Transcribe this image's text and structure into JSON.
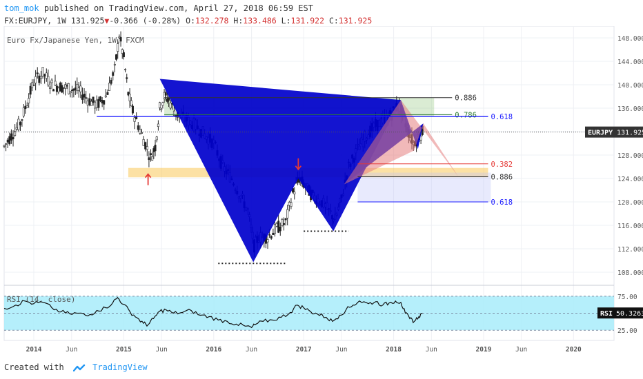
{
  "header": {
    "user": "tom_mok",
    "published": "published on TradingView.com, April 27, 2018 06:59 EST"
  },
  "quote": {
    "symbol": "FX:EURJPY, 1W 131.925",
    "change": "-0.366 (-0.28%)",
    "open_label": "O:",
    "open": "132.278",
    "high_label": "H:",
    "high": "133.486",
    "low_label": "L:",
    "low": "131.922",
    "close_label": "C:",
    "close": "131.925"
  },
  "footer": {
    "created_with": "Created with",
    "brand": "TradingView"
  },
  "colors": {
    "bull": "#0000cc",
    "bear": "#e58080",
    "rsi_band": "#a8ecfa",
    "neg": "#d32f2f",
    "accent": "#2196f3"
  },
  "chart_data": {
    "type": "candlestick",
    "title": "Euro Fx/Japanese Yen, 1W, FXCM",
    "price_axis": {
      "ticks": [
        108,
        112,
        116,
        120,
        124,
        128,
        132,
        136,
        140,
        144,
        148
      ],
      "ylim": [
        106,
        150
      ]
    },
    "x_axis": {
      "range": [
        2013.67,
        2020.45
      ],
      "ticks": [
        {
          "x": 2014.0,
          "label": "2014"
        },
        {
          "x": 2014.42,
          "label": "Jun"
        },
        {
          "x": 2015.0,
          "label": "2015"
        },
        {
          "x": 2015.42,
          "label": "Jun"
        },
        {
          "x": 2016.0,
          "label": "2016"
        },
        {
          "x": 2016.42,
          "label": "Jun"
        },
        {
          "x": 2017.0,
          "label": "2017"
        },
        {
          "x": 2017.42,
          "label": "Jun"
        },
        {
          "x": 2018.0,
          "label": "2018"
        },
        {
          "x": 2018.42,
          "label": "Jun"
        },
        {
          "x": 2019.0,
          "label": "2019"
        },
        {
          "x": 2019.42,
          "label": "Jun"
        },
        {
          "x": 2020.0,
          "label": "2020"
        }
      ]
    },
    "last_price": {
      "label": "EURJPY",
      "value": "131.925"
    },
    "price_path": [
      [
        2013.67,
        129.5
      ],
      [
        2013.85,
        133.5
      ],
      [
        2014.0,
        140.5
      ],
      [
        2014.1,
        142.0
      ],
      [
        2014.2,
        140.0
      ],
      [
        2014.35,
        139.5
      ],
      [
        2014.5,
        139.0
      ],
      [
        2014.6,
        137.5
      ],
      [
        2014.7,
        136.5
      ],
      [
        2014.8,
        138.0
      ],
      [
        2014.9,
        142.5
      ],
      [
        2014.95,
        148.5
      ],
      [
        2015.0,
        144.5
      ],
      [
        2015.05,
        138.5
      ],
      [
        2015.1,
        135.5
      ],
      [
        2015.2,
        131.5
      ],
      [
        2015.3,
        127.5
      ],
      [
        2015.35,
        129.5
      ],
      [
        2015.4,
        136.0
      ],
      [
        2015.45,
        138.0
      ],
      [
        2015.5,
        137.5
      ],
      [
        2015.58,
        135.0
      ],
      [
        2015.7,
        134.0
      ],
      [
        2015.8,
        133.0
      ],
      [
        2015.9,
        131.5
      ],
      [
        2016.0,
        130.0
      ],
      [
        2016.1,
        126.0
      ],
      [
        2016.2,
        124.0
      ],
      [
        2016.3,
        121.0
      ],
      [
        2016.38,
        118.5
      ],
      [
        2016.45,
        112.5
      ],
      [
        2016.5,
        114.0
      ],
      [
        2016.6,
        114.0
      ],
      [
        2016.7,
        115.5
      ],
      [
        2016.8,
        116.5
      ],
      [
        2016.88,
        121.5
      ],
      [
        2016.95,
        124.0
      ],
      [
        2017.0,
        123.0
      ],
      [
        2017.1,
        121.0
      ],
      [
        2017.2,
        120.0
      ],
      [
        2017.3,
        118.0
      ],
      [
        2017.35,
        117.0
      ],
      [
        2017.42,
        120.5
      ],
      [
        2017.5,
        126.0
      ],
      [
        2017.6,
        129.0
      ],
      [
        2017.7,
        131.5
      ],
      [
        2017.8,
        133.0
      ],
      [
        2017.9,
        134.0
      ],
      [
        2017.98,
        135.0
      ],
      [
        2018.05,
        136.5
      ],
      [
        2018.1,
        135.0
      ],
      [
        2018.15,
        132.5
      ],
      [
        2018.22,
        130.0
      ],
      [
        2018.27,
        131.0
      ],
      [
        2018.32,
        131.925
      ]
    ],
    "harmonic_patterns": [
      {
        "color": "bull",
        "points": [
          [
            2015.4,
            141.0
          ],
          [
            2016.44,
            109.7
          ],
          [
            2016.94,
            124.0
          ],
          [
            2017.33,
            115.0
          ],
          [
            2018.08,
            137.4
          ]
        ]
      },
      {
        "color": "bull",
        "points": [
          [
            2017.45,
            123.0
          ],
          [
            2018.08,
            137.4
          ],
          [
            2018.27,
            129.0
          ],
          [
            2018.33,
            133.4
          ]
        ]
      },
      {
        "color": "bear",
        "points": [
          [
            2017.45,
            123.0
          ],
          [
            2018.08,
            137.4
          ],
          [
            2018.23,
            128.8
          ]
        ]
      },
      {
        "color": "bear",
        "points": [
          [
            2018.08,
            137.4
          ],
          [
            2018.23,
            128.8
          ],
          [
            2018.33,
            133.4
          ],
          [
            2018.72,
            124.3
          ]
        ]
      }
    ],
    "zones": [
      {
        "color": "green",
        "x": [
          2015.45,
          2018.45
        ],
        "y": [
          134.6,
          137.8
        ]
      },
      {
        "color": "orange",
        "x": [
          2015.05,
          2019.05
        ],
        "y": [
          124.2,
          125.8
        ]
      },
      {
        "color": "lavender",
        "x": [
          2017.6,
          2019.08
        ],
        "y": [
          120.0,
          125.0
        ]
      }
    ],
    "levels": [
      {
        "label": "0.886",
        "y": 137.8,
        "x": [
          2015.45,
          2018.65
        ],
        "color": "#333333"
      },
      {
        "label": "0.786",
        "y": 134.9,
        "x": [
          2015.45,
          2018.65
        ],
        "color": "#2e7d32"
      },
      {
        "label": "0.618",
        "y": 134.6,
        "x": [
          2014.7,
          2019.05
        ],
        "color": "#1a1aff"
      },
      {
        "label": "0.382",
        "y": 126.5,
        "x": [
          2017.6,
          2019.05
        ],
        "color": "#e53935"
      },
      {
        "label": "0.886",
        "y": 124.3,
        "x": [
          2017.6,
          2019.05
        ],
        "color": "#333333"
      },
      {
        "label": "0.618",
        "y": 120.0,
        "x": [
          2017.6,
          2019.05
        ],
        "color": "#1a1aff"
      }
    ],
    "dotted_lows": [
      {
        "x": [
          2016.05,
          2016.8
        ],
        "y": 109.5
      },
      {
        "x": [
          2017.0,
          2017.5
        ],
        "y": 115.0
      }
    ],
    "markers": [
      {
        "type": "up-arrow",
        "x": 2015.27,
        "y": 123.8,
        "color": "#e53935"
      },
      {
        "type": "down-arrow",
        "x": 2016.94,
        "y": 126.5,
        "color": "#e53935"
      }
    ],
    "rsi": {
      "label": "RSI (14, close)",
      "ticks": [
        25.0,
        50.0,
        75.0
      ],
      "ylim": [
        10,
        85
      ],
      "band": [
        25.0,
        75.0
      ],
      "value_label": "RSI",
      "value": "50.3263",
      "points": [
        [
          2013.67,
          57
        ],
        [
          2013.8,
          62
        ],
        [
          2013.9,
          68
        ],
        [
          2014.0,
          64
        ],
        [
          2014.1,
          66
        ],
        [
          2014.2,
          58
        ],
        [
          2014.3,
          52
        ],
        [
          2014.4,
          49
        ],
        [
          2014.5,
          50
        ],
        [
          2014.6,
          46
        ],
        [
          2014.7,
          54
        ],
        [
          2014.8,
          58
        ],
        [
          2014.88,
          66
        ],
        [
          2014.93,
          73
        ],
        [
          2015.0,
          63
        ],
        [
          2015.07,
          52
        ],
        [
          2015.15,
          43
        ],
        [
          2015.22,
          35
        ],
        [
          2015.27,
          33
        ],
        [
          2015.33,
          42
        ],
        [
          2015.4,
          53
        ],
        [
          2015.47,
          55
        ],
        [
          2015.55,
          50
        ],
        [
          2015.65,
          51
        ],
        [
          2015.75,
          54
        ],
        [
          2015.85,
          47
        ],
        [
          2015.95,
          45
        ],
        [
          2016.05,
          40
        ],
        [
          2016.15,
          38
        ],
        [
          2016.25,
          34
        ],
        [
          2016.35,
          31
        ],
        [
          2016.42,
          29
        ],
        [
          2016.47,
          34
        ],
        [
          2016.55,
          38
        ],
        [
          2016.65,
          40
        ],
        [
          2016.75,
          44
        ],
        [
          2016.85,
          51
        ],
        [
          2016.93,
          62
        ],
        [
          2017.0,
          58
        ],
        [
          2017.08,
          52
        ],
        [
          2017.15,
          49
        ],
        [
          2017.25,
          44
        ],
        [
          2017.32,
          38
        ],
        [
          2017.4,
          47
        ],
        [
          2017.47,
          55
        ],
        [
          2017.55,
          62
        ],
        [
          2017.62,
          68
        ],
        [
          2017.72,
          64
        ],
        [
          2017.8,
          67
        ],
        [
          2017.88,
          62
        ],
        [
          2017.95,
          65
        ],
        [
          2018.02,
          68
        ],
        [
          2018.08,
          66
        ],
        [
          2018.13,
          50
        ],
        [
          2018.18,
          42
        ],
        [
          2018.23,
          38
        ],
        [
          2018.28,
          45
        ],
        [
          2018.32,
          50
        ]
      ]
    }
  }
}
